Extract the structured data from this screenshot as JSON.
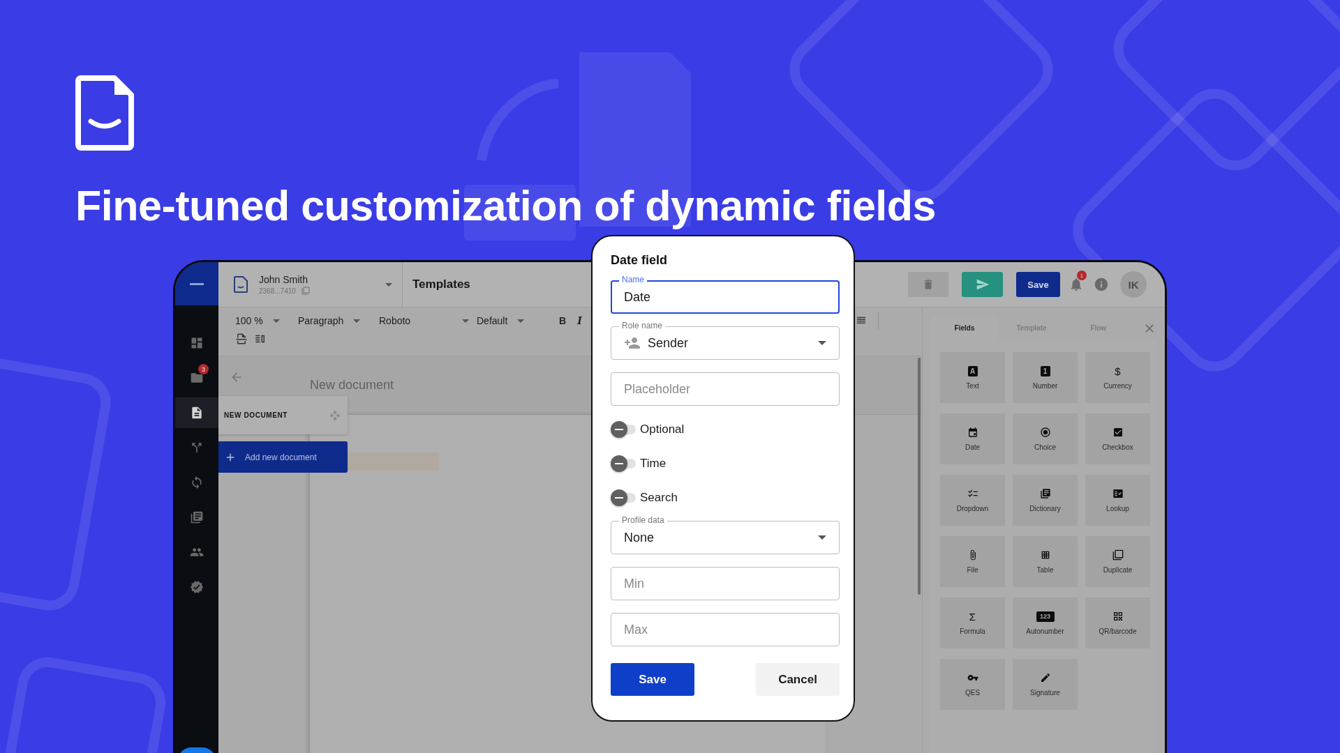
{
  "headline": "Fine-tuned customization of dynamic fields",
  "app": {
    "sidebar": {
      "items": [
        {
          "kind": "dashboard",
          "selected": false
        },
        {
          "kind": "folder",
          "selected": false,
          "badge": "3"
        },
        {
          "kind": "document",
          "selected": true
        },
        {
          "kind": "flow",
          "selected": false
        },
        {
          "kind": "sync",
          "selected": false
        },
        {
          "kind": "library",
          "selected": false
        },
        {
          "kind": "people",
          "selected": false
        },
        {
          "kind": "verified",
          "selected": false
        }
      ]
    },
    "header": {
      "user_name": "John Smith",
      "account_id": "2368...7410",
      "section_title": "Templates",
      "save_label": "Save",
      "notification_count": "1",
      "avatar_initials": "IK"
    },
    "toolbar": {
      "zoom": "100 %",
      "block_style": "Paragraph",
      "font": "Roboto",
      "size": "Default",
      "bold": "B",
      "italic": "I"
    },
    "editor": {
      "document_title": "New document",
      "document_card": "NEW DOCUMENT",
      "add_button": "Add new document"
    },
    "fields_panel": {
      "tabs": [
        {
          "label": "Fields",
          "selected": true
        },
        {
          "label": "Template",
          "selected": false
        },
        {
          "label": "Flow",
          "selected": false
        }
      ],
      "items": [
        {
          "label": "Text",
          "kind": "boxed",
          "glyph": "A"
        },
        {
          "label": "Number",
          "kind": "boxed",
          "glyph": "1"
        },
        {
          "label": "Currency",
          "kind": "glyph",
          "glyph": "$"
        },
        {
          "label": "Date",
          "kind": "date"
        },
        {
          "label": "Choice",
          "kind": "radio"
        },
        {
          "label": "Checkbox",
          "kind": "checkbox"
        },
        {
          "label": "Dropdown",
          "kind": "checklist"
        },
        {
          "label": "Dictionary",
          "kind": "library"
        },
        {
          "label": "Lookup",
          "kind": "lookup"
        },
        {
          "label": "File",
          "kind": "attach"
        },
        {
          "label": "Table",
          "kind": "grid"
        },
        {
          "label": "Duplicate",
          "kind": "copy"
        },
        {
          "label": "Formula",
          "kind": "glyph",
          "glyph": "Σ"
        },
        {
          "label": "Autonumber",
          "kind": "boxed",
          "glyph": "123"
        },
        {
          "label": "QR/barcode",
          "kind": "qr"
        },
        {
          "label": "QES",
          "kind": "key"
        },
        {
          "label": "Signature",
          "kind": "pen"
        }
      ]
    }
  },
  "dialog": {
    "title": "Date field",
    "name_field": {
      "label": "Name",
      "value": "Date"
    },
    "role_field": {
      "label": "Role name",
      "value": "Sender"
    },
    "placeholder_field": {
      "placeholder": "Placeholder"
    },
    "toggles": [
      {
        "label": "Optional",
        "on": false
      },
      {
        "label": "Time",
        "on": false
      },
      {
        "label": "Search",
        "on": false
      }
    ],
    "profile_field": {
      "label": "Profile data",
      "value": "None"
    },
    "min_field": {
      "placeholder": "Min"
    },
    "max_field": {
      "placeholder": "Max"
    },
    "buttons": [
      {
        "label": "Save",
        "kind": "primary"
      },
      {
        "label": "Cancel",
        "kind": "secondary"
      }
    ]
  }
}
